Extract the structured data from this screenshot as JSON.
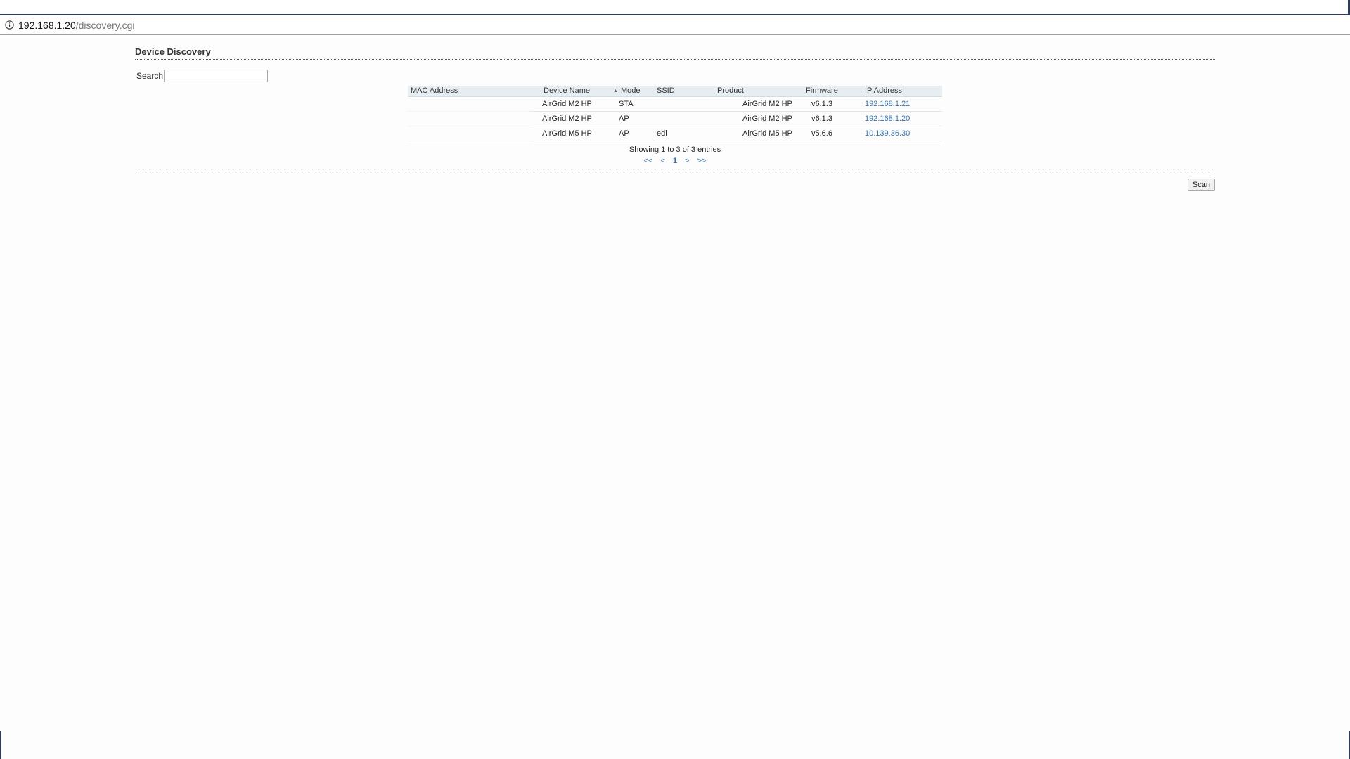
{
  "address_bar": {
    "host": "192.168.1.20",
    "path": "/discovery.cgi",
    "icon": "info-icon"
  },
  "page": {
    "title": "Device Discovery",
    "search_label": "Search",
    "search_value": "",
    "scan_button": "Scan"
  },
  "table": {
    "sorted_column": "Mode",
    "columns": {
      "mac": "MAC Address",
      "device_name": "Device Name",
      "mode": "Mode",
      "ssid": "SSID",
      "product": "Product",
      "firmware": "Firmware",
      "ip": "IP Address"
    },
    "rows": [
      {
        "mac": "",
        "device_name": "AirGrid M2 HP",
        "mode": "STA",
        "ssid": "",
        "product": "AirGrid M2 HP",
        "firmware": "v6.1.3",
        "ip": "192.168.1.21"
      },
      {
        "mac": "",
        "device_name": "AirGrid M2 HP",
        "mode": "AP",
        "ssid": "",
        "product": "AirGrid M2 HP",
        "firmware": "v6.1.3",
        "ip": "192.168.1.20"
      },
      {
        "mac": "",
        "device_name": "AirGrid M5 HP",
        "mode": "AP",
        "ssid": "edi",
        "product": "AirGrid M5 HP",
        "firmware": "v5.6.6",
        "ip": "10.139.36.30"
      }
    ],
    "info": "Showing 1 to 3 of 3 entries",
    "pager": {
      "first": "<<",
      "prev": "<",
      "current": "1",
      "next": ">",
      "last": ">>"
    }
  }
}
